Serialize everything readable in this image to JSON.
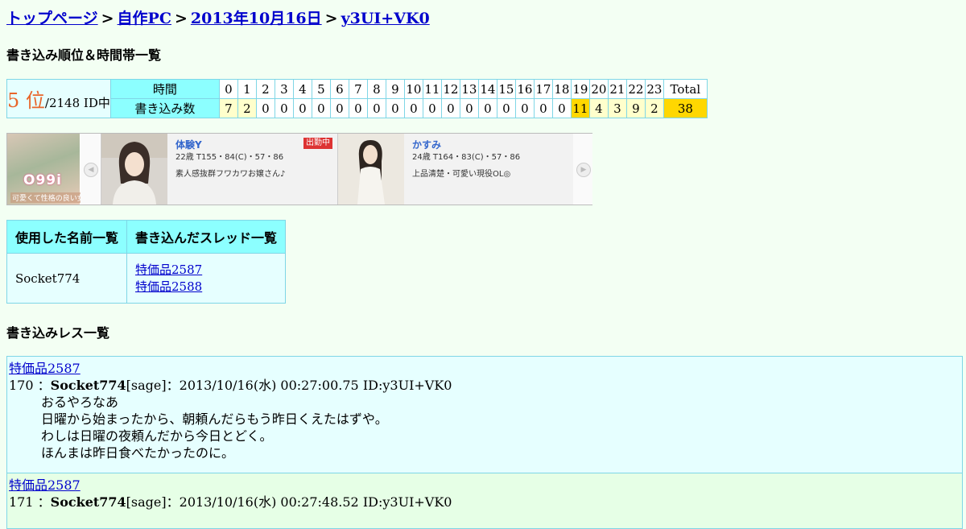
{
  "breadcrumb": {
    "items": [
      "トップページ",
      "自作PC",
      "2013年10月16日",
      "y3UI+VK0"
    ],
    "separator": ">"
  },
  "ranking": {
    "heading": "書き込み順位＆時間帯一覧",
    "rank_value": "5 位",
    "rank_total": "/2148 ID中",
    "time_label": "時間",
    "count_label": "書き込み数",
    "hours": [
      "0",
      "1",
      "2",
      "3",
      "4",
      "5",
      "6",
      "7",
      "8",
      "9",
      "10",
      "11",
      "12",
      "13",
      "14",
      "15",
      "16",
      "17",
      "18",
      "19",
      "20",
      "21",
      "22",
      "23",
      "Total"
    ],
    "counts": [
      "7",
      "2",
      "0",
      "0",
      "0",
      "0",
      "0",
      "0",
      "0",
      "0",
      "0",
      "0",
      "0",
      "0",
      "0",
      "0",
      "0",
      "0",
      "0",
      "11",
      "4",
      "3",
      "9",
      "2",
      "38"
    ]
  },
  "ad": {
    "logo_text": "O99i",
    "logo_sub": "可愛くて性格の良い女",
    "card1": {
      "name": "体験Y",
      "badge": "出勤中",
      "spec": "22歳 T155・84(C)・57・86",
      "desc": "素人感抜群フワカワお嬢さん♪"
    },
    "card2": {
      "name": "かすみ",
      "spec": "24歳 T164・83(C)・57・86",
      "desc": "上品清楚・可愛い現役OL◎"
    }
  },
  "names_table": {
    "col_names": "使用した名前一覧",
    "col_threads": "書き込んだスレッド一覧",
    "name": "Socket774",
    "threads": [
      "特価品2587",
      "特価品2588"
    ]
  },
  "posts_heading": "書き込みレス一覧",
  "posts": [
    {
      "thread": "特価品2587",
      "num": "170",
      "author": "Socket774",
      "mail": "[sage]",
      "datetime": "2013/10/16(水) 00:27:00.75 ID:y3UI+VK0",
      "lines": [
        "おるやろなあ",
        "日曜から始まったから、朝頼んだらもう昨日くえたはずや。",
        "わしは日曜の夜頼んだから今日とどく。",
        "ほんまは昨日食べたかったのに。"
      ]
    },
    {
      "thread": "特価品2587",
      "num": "171",
      "author": "Socket774",
      "mail": "[sage]",
      "datetime": "2013/10/16(水) 00:27:48.52 ID:y3UI+VK0",
      "lines": []
    }
  ]
}
